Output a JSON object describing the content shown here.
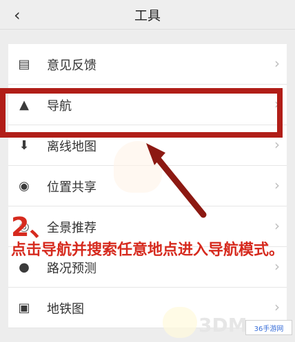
{
  "header": {
    "back_glyph": "‹",
    "title": "工具"
  },
  "menu": [
    {
      "icon": "feedback-icon",
      "glyph": "▤",
      "label": "意见反馈",
      "chevron": "›"
    },
    {
      "icon": "navigation-icon",
      "glyph": "▲",
      "label": "导航",
      "chevron": "›"
    },
    {
      "icon": "offline-map-icon",
      "glyph": "⬇",
      "label": "离线地图",
      "chevron": "›"
    },
    {
      "icon": "location-share-icon",
      "glyph": "◉",
      "label": "位置共享",
      "chevron": "›"
    },
    {
      "icon": "panorama-icon",
      "glyph": "◎",
      "label": "全景推荐",
      "chevron": "›"
    },
    {
      "icon": "traffic-forecast-icon",
      "glyph": "●",
      "label": "路况预测",
      "chevron": "›"
    },
    {
      "icon": "metro-map-icon",
      "glyph": "▣",
      "label": "地铁图",
      "chevron": "›"
    }
  ],
  "annotation": {
    "step": "2、",
    "instruction": "点击导航并搜索任意地点进入导航模式。",
    "highlight_color": "#b11e18",
    "text_color": "#d62a1e"
  },
  "watermark": {
    "text": "3DM",
    "badge": "36手游网"
  }
}
